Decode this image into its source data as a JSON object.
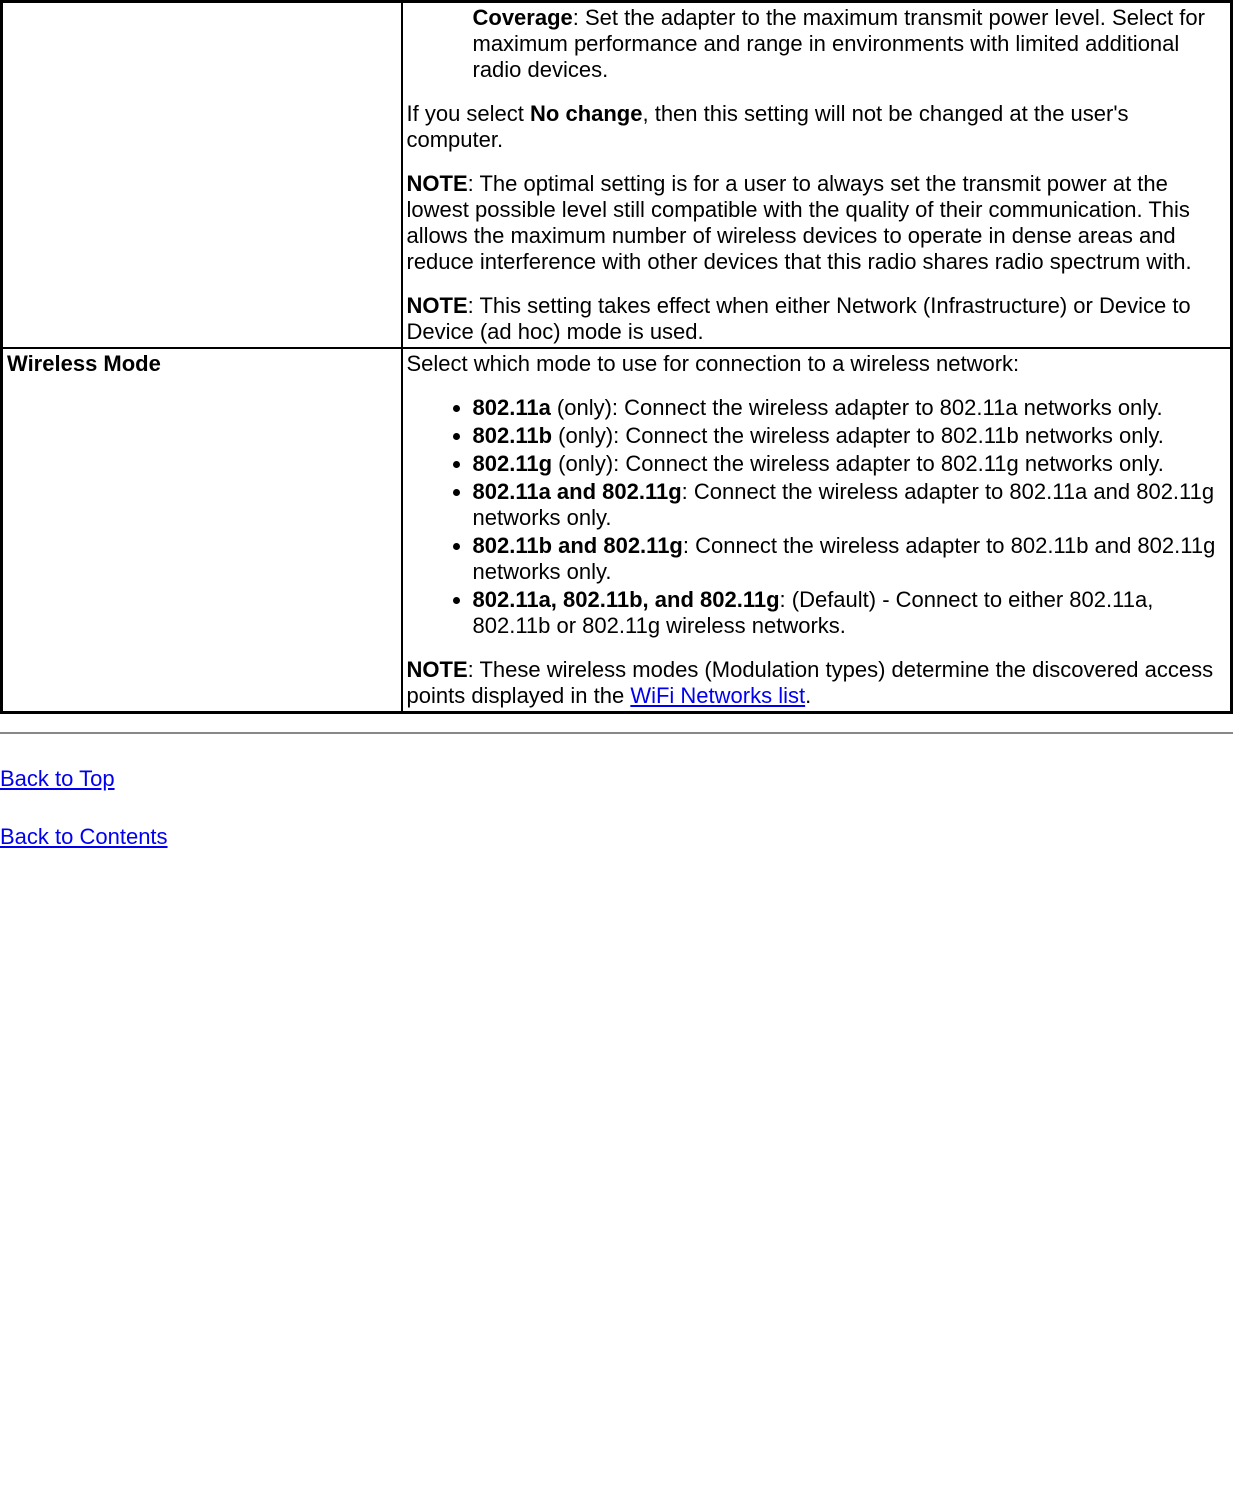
{
  "row1": {
    "coverage_label": "Coverage",
    "coverage_text": ": Set the adapter to the maximum transmit power level. Select for maximum performance and range in environments with limited additional radio devices.",
    "nochange_pre": "If you select ",
    "nochange_bold": "No change",
    "nochange_post": ", then this setting will not be changed at the user's computer.",
    "note1_label": "NOTE",
    "note1_text": ": The optimal setting is for a user to always set the transmit power at the lowest possible level still compatible with the quality of their communication. This allows the maximum number of wireless devices to operate in dense areas and reduce interference with other devices that this radio shares radio spectrum with.",
    "note2_label": "NOTE",
    "note2_text": ": This setting takes effect when either Network (Infrastructure) or Device to Device (ad hoc) mode is used."
  },
  "row2": {
    "label": "Wireless Mode",
    "intro": "Select which mode to use for connection to a wireless network:",
    "modes": [
      {
        "bold": "802.11a",
        "text": " (only): Connect the wireless adapter to 802.11a networks only."
      },
      {
        "bold": "802.11b",
        "text": " (only): Connect the wireless adapter to 802.11b networks only."
      },
      {
        "bold": "802.11g",
        "text": " (only): Connect the wireless adapter to 802.11g networks only."
      },
      {
        "bold": "802.11a and 802.11g",
        "text": ": Connect the wireless adapter to 802.11a and 802.11g networks only."
      },
      {
        "bold": "802.11b and 802.11g",
        "text": ": Connect the wireless adapter to 802.11b and 802.11g networks only."
      },
      {
        "bold": "802.11a, 802.11b, and 802.11g",
        "text": ": (Default) - Connect to either 802.11a, 802.11b or 802.11g wireless networks."
      }
    ],
    "note_label": "NOTE",
    "note_pre": ": These wireless modes (Modulation types) determine the discovered access points displayed in the ",
    "note_link": "WiFi Networks list",
    "note_post": "."
  },
  "footer": {
    "back_top": "Back to Top",
    "back_contents": "Back to Contents"
  }
}
